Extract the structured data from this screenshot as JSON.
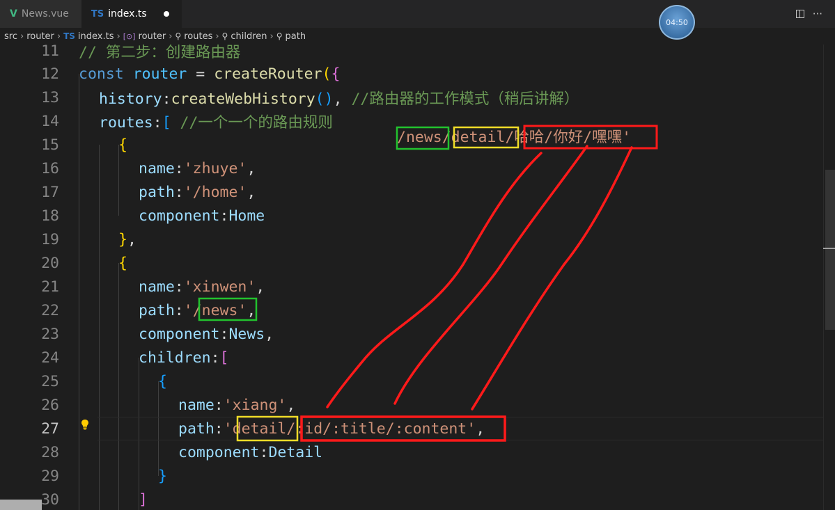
{
  "tabs": [
    {
      "icon": "vue-icon",
      "icon_text": "V",
      "label": "News.vue",
      "active": false
    },
    {
      "icon": "ts-icon",
      "icon_text": "TS",
      "label": "index.ts",
      "active": true,
      "dirty": true
    }
  ],
  "timer": "04:50",
  "tab_actions": {
    "more": "···"
  },
  "breadcrumb": [
    {
      "label": "src"
    },
    {
      "label": "router"
    },
    {
      "icon_text": "TS",
      "label": "index.ts"
    },
    {
      "icon_text": "[⊙]",
      "label": "router"
    },
    {
      "icon_text": "🔧",
      "label": "routes"
    },
    {
      "icon_text": "🔧",
      "label": "children"
    },
    {
      "icon_text": "🔧",
      "label": "path"
    }
  ],
  "line_numbers": [
    "11",
    "12",
    "13",
    "14",
    "15",
    "16",
    "17",
    "18",
    "19",
    "20",
    "21",
    "22",
    "23",
    "24",
    "25",
    "26",
    "27",
    "28",
    "29",
    "30"
  ],
  "current_line": "27",
  "code": {
    "l11": "// 第二步：创建路由器",
    "l12_const": "const",
    "l12_router": "router",
    "l12_eq": " = ",
    "l12_fn": "createRouter",
    "l12_p": "(",
    "l12_b": "{",
    "l13_prop": "history",
    "l13_colon": ":",
    "l13_fn": "createWebHistory",
    "l13_parens": "()",
    "l13_comma": ", ",
    "l13_cmt": "//路由器的工作模式（稍后讲解）",
    "l14_prop": "routes",
    "l14_colon": ":",
    "l14_br": "[",
    "l14_cmt": " //一个一个的路由规则",
    "l15": "{",
    "l16_prop": "name",
    "l16_colon": ":",
    "l16_str": "'zhuye'",
    "l16_comma": ",",
    "l17_prop": "path",
    "l17_colon": ":",
    "l17_str": "'/home'",
    "l17_comma": ",",
    "l18_prop": "component",
    "l18_colon": ":",
    "l18_val": "Home",
    "l19_b": "}",
    "l19_comma": ",",
    "l20": "{",
    "l21_prop": "name",
    "l21_colon": ":",
    "l21_str": "'xinwen'",
    "l21_comma": ",",
    "l22_prop": "path",
    "l22_colon": ":",
    "l22_q1": "'",
    "l22_str": "/news",
    "l22_q2": "'",
    "l22_comma": ",",
    "l23_prop": "component",
    "l23_colon": ":",
    "l23_val": "News",
    "l23_comma": ",",
    "l24_prop": "children",
    "l24_colon": ":",
    "l24_br": "[",
    "l25": "{",
    "l26_prop": "name",
    "l26_colon": ":",
    "l26_str": "'xiang'",
    "l26_comma": ",",
    "l27_prop": "path",
    "l27_colon": ":",
    "l27_q1": "'",
    "l27_detail": "detail",
    "l27_params": "/:id/:title/:content'",
    "l27_comma": ",",
    "l28_prop": "component",
    "l28_colon": ":",
    "l28_val": "Detail",
    "l29": "}",
    "l30": "]"
  },
  "overlay_path": {
    "news": "/news",
    "detail": "/detail",
    "params": "/哈哈/你好/嘿嘿'"
  },
  "annotation_colors": {
    "green": "#22c22e",
    "yellow": "#f0dc28",
    "red": "#ff1a1a"
  }
}
